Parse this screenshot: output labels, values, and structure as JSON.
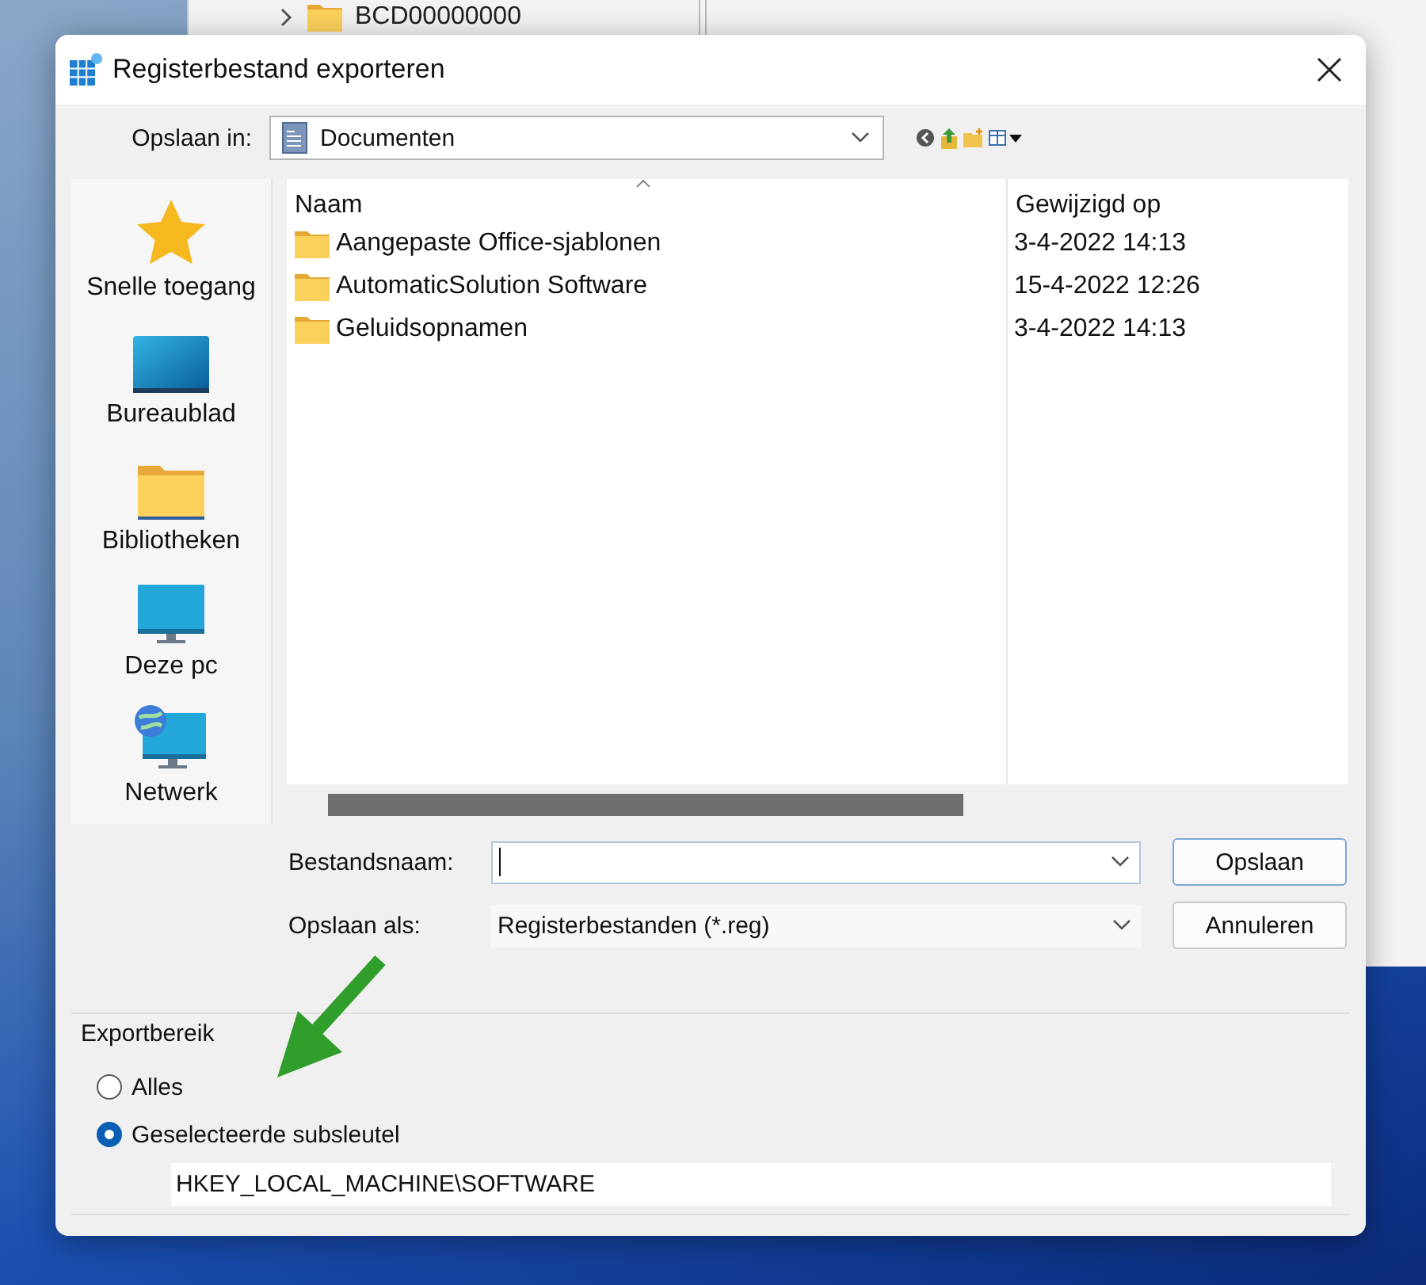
{
  "background_window": {
    "tree_item": {
      "label": "BCD00000000",
      "expanded": false
    }
  },
  "dialog": {
    "title": "Registerbestand exporteren",
    "save_in": {
      "label": "Opslaan in:",
      "value": "Documenten"
    },
    "sidebar": {
      "items": [
        {
          "kind": "star",
          "label": "Snelle toegang"
        },
        {
          "kind": "desktop",
          "label": "Bureaublad"
        },
        {
          "kind": "library",
          "label": "Bibliotheken"
        },
        {
          "kind": "pc",
          "label": "Deze pc"
        },
        {
          "kind": "network",
          "label": "Netwerk"
        }
      ]
    },
    "file_list": {
      "columns": [
        {
          "label": "Naam",
          "sorted": true
        },
        {
          "label": "Gewijzigd op",
          "sorted": false
        }
      ],
      "rows": [
        {
          "name": "Aangepaste Office-sjablonen",
          "modified": "3-4-2022 14:13"
        },
        {
          "name": "AutomaticSolution Software",
          "modified": "15-4-2022 12:26"
        },
        {
          "name": "Geluidsopnamen",
          "modified": "3-4-2022 14:13"
        }
      ]
    },
    "file_name": {
      "label": "Bestandsnaam:"
    },
    "save_as": {
      "label": "Opslaan als:",
      "value": "Registerbestanden (*.reg)"
    },
    "buttons": [
      {
        "label": "Opslaan",
        "default": true
      },
      {
        "label": "Annuleren",
        "default": false
      }
    ],
    "export_range": {
      "title": "Exportbereik",
      "options": [
        {
          "label": "Alles",
          "selected": false
        },
        {
          "label": "Geselecteerde subsleutel",
          "selected": true
        }
      ],
      "key_path": "HKEY_LOCAL_MACHINE\\SOFTWARE"
    }
  }
}
